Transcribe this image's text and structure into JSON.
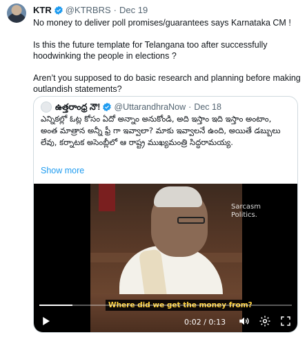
{
  "tweet": {
    "author_name": "KTR",
    "author_handle": "@KTRBRS",
    "separator": "·",
    "date": "Dec 19",
    "paragraphs": [
      "No money to deliver poll promises/guarantees says Karnataka CM !",
      "Is this the future template for Telangana too after successfully hoodwinking the people in elections ?",
      "Aren’t you supposed to do basic research and planning before making outlandish statements?"
    ]
  },
  "quoted": {
    "author_name": "ఉత్తరాంధ్ర నౌ!",
    "author_handle": "@UttarandhraNow",
    "separator": "·",
    "date": "Dec 18",
    "text": "ఎన్నికల్లో ఓట్ల కోసం ఏదో అన్నాం అనుకోండి, అది ఇస్తాం ఇది ఇస్తాం అంటాం, అంత మాత్రాన అన్నీ ఫ్రీ గా ఇవ్వాలా? మాకు ఇవ్వాలనే ఉంది, అయితే డబ్బులు లేవు, కర్నాటక అసెంబ్లీలో ఆ రాష్ట్ర ముఖ్యమంత్రి సిద్ధరామయ్య.",
    "show_more": "Show more"
  },
  "video": {
    "watermark_line1": "Sarcasm",
    "watermark_line2": "Politics.",
    "caption": "Where did we get the money from?",
    "time_display": "0:02 / 0:13",
    "progress_fraction": 0.13,
    "icons": [
      "play-icon",
      "volume-icon",
      "settings-icon",
      "fullscreen-icon"
    ]
  },
  "colors": {
    "accent": "#1d9bf0",
    "caption": "#ffd23f",
    "secondary_text": "#536471"
  }
}
